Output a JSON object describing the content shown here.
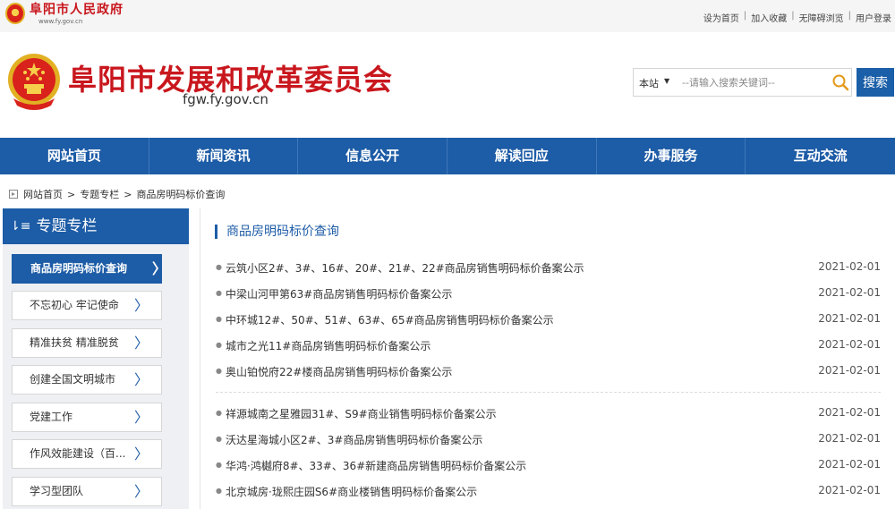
{
  "topbar": {
    "logo_title": "阜阳市人民政府",
    "logo_url": "www.fy.gov.cn",
    "links": [
      "设为首页",
      "加入收藏",
      "无障碍浏览",
      "用户登录"
    ]
  },
  "header": {
    "title": "阜阳市发展和改革委员会",
    "url": "fgw.fy.gov.cn",
    "search": {
      "scope": "本站",
      "placeholder": "--请输入搜索关键词--",
      "button": "搜索"
    }
  },
  "nav": [
    "网站首页",
    "新闻资讯",
    "信息公开",
    "解读回应",
    "办事服务",
    "互动交流"
  ],
  "breadcrumb": [
    "网站首页",
    "专题专栏",
    "商品房明码标价查询"
  ],
  "sidebar": {
    "title": "专题专栏",
    "items": [
      "商品房明码标价查询",
      "不忘初心 牢记使命",
      "精准扶贫 精准脱贫",
      "创建全国文明城市",
      "党建工作",
      "作风效能建设（百...",
      "学习型团队"
    ]
  },
  "content": {
    "title": "商品房明码标价查询",
    "items": [
      {
        "text": "云筑小区2#、3#、16#、20#、21#、22#商品房销售明码标价备案公示",
        "date": "2021-02-01"
      },
      {
        "text": "中梁山河甲第63#商品房销售明码标价备案公示",
        "date": "2021-02-01"
      },
      {
        "text": "中环城12#、50#、51#、63#、65#商品房销售明码标价备案公示",
        "date": "2021-02-01"
      },
      {
        "text": "城市之光11#商品房销售明码标价备案公示",
        "date": "2021-02-01"
      },
      {
        "text": "奥山铂悦府22#楼商品房销售明码标价备案公示",
        "date": "2021-02-01"
      },
      {
        "text": "祥源城南之星雅园31#、S9#商业销售明码标价备案公示",
        "date": "2021-02-01"
      },
      {
        "text": "沃达星海城小区2#、3#商品房销售明码标价备案公示",
        "date": "2021-02-01"
      },
      {
        "text": "华鸿·鸿樾府8#、33#、36#新建商品房销售明码标价备案公示",
        "date": "2021-02-01"
      },
      {
        "text": "北京城房·珑熙庄园S6#商业楼销售明码标价备案公示",
        "date": "2021-02-01"
      }
    ]
  },
  "colors": {
    "brand_red": "#c9171e",
    "brand_blue": "#1d5ca6"
  },
  "icons": {
    "emblem": "national-emblem-icon",
    "search": "magnifier-icon",
    "chevron": "chevron-right-icon",
    "sidebar_head": "list-icon"
  }
}
